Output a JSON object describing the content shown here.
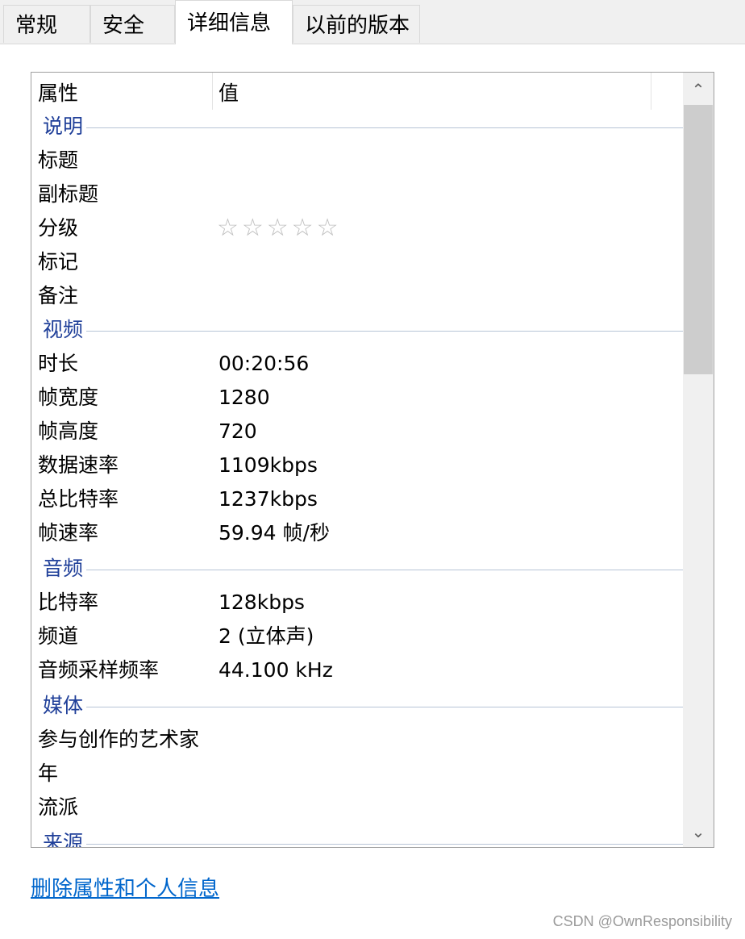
{
  "tabs": [
    {
      "label": "常规"
    },
    {
      "label": "安全"
    },
    {
      "label": "详细信息"
    },
    {
      "label": "以前的版本"
    }
  ],
  "columns": {
    "property": "属性",
    "value": "值"
  },
  "groups": {
    "description": "说明",
    "video": "视频",
    "audio": "音频",
    "media": "媒体",
    "origin": "来源"
  },
  "rows": {
    "title": {
      "name": "标题",
      "value": ""
    },
    "subtitle": {
      "name": "副标题",
      "value": ""
    },
    "rating": {
      "name": "分级",
      "value": "☆☆☆☆☆",
      "stars_filled": 0,
      "stars_total": 5
    },
    "tags": {
      "name": "标记",
      "value": ""
    },
    "comments": {
      "name": "备注",
      "value": ""
    },
    "length": {
      "name": "时长",
      "value": "00:20:56"
    },
    "frame_width": {
      "name": "帧宽度",
      "value": "1280"
    },
    "frame_height": {
      "name": "帧高度",
      "value": "720"
    },
    "data_rate": {
      "name": "数据速率",
      "value": "1109kbps"
    },
    "total_bitrate": {
      "name": "总比特率",
      "value": "1237kbps"
    },
    "frame_rate": {
      "name": "帧速率",
      "value": "59.94 帧/秒"
    },
    "audio_bitrate": {
      "name": "比特率",
      "value": "128kbps"
    },
    "channels": {
      "name": "频道",
      "value": "2 (立体声)"
    },
    "sample_rate": {
      "name": "音频采样频率",
      "value": "44.100 kHz"
    },
    "contributing_artists": {
      "name": "参与创作的艺术家",
      "value": ""
    },
    "year": {
      "name": "年",
      "value": ""
    },
    "genre": {
      "name": "流派",
      "value": ""
    }
  },
  "scrollbar": {
    "up_icon": "chevron-up-icon",
    "down_icon": "chevron-down-icon",
    "up_glyph": "⌃",
    "down_glyph": "⌄"
  },
  "footer": {
    "remove_link": "删除属性和个人信息"
  },
  "watermark": "CSDN @OwnResponsibility",
  "colors": {
    "group_header": "#1f3f99",
    "link": "#0066cc",
    "star": "#bdbdbd"
  }
}
